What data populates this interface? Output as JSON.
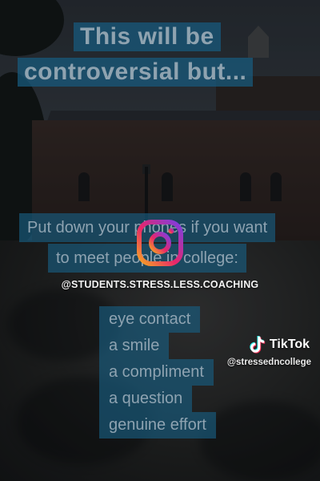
{
  "overlay": {
    "title_lines": [
      "This will be",
      "controversial but..."
    ],
    "body_lines": [
      "Put down your phones if you want",
      "to meet people in college:"
    ],
    "list_items": [
      "eye contact",
      "a smile",
      "a compliment",
      "a question",
      "genuine effort"
    ]
  },
  "instagram": {
    "icon": "instagram-logo-icon",
    "handle": "@STUDENTS.STRESS.LESS.COACHING"
  },
  "tiktok": {
    "icon": "tiktok-note-icon",
    "brand": "TikTok",
    "username": "@stressedncollege"
  },
  "colors": {
    "text_box_bg": "#185c80",
    "text_color": "#8ea3b1",
    "ig_gradient_start": "#7b3fe4",
    "ig_gradient_end": "#f5a623"
  }
}
